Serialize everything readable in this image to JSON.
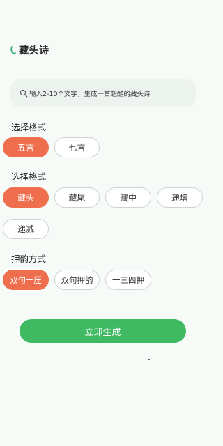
{
  "header": {
    "title": "藏头诗",
    "back_icon": "back-arc-icon"
  },
  "search": {
    "text": "输入2-10个文字，生成一首超酷的藏头诗",
    "icon": "search-icon"
  },
  "sections": [
    {
      "label": "选择格式",
      "options": [
        "五言",
        "七言"
      ],
      "selected": 0
    },
    {
      "label": "选择格式",
      "options": [
        "藏头",
        "藏尾",
        "藏中",
        "递增",
        "递减"
      ],
      "selected": 0
    },
    {
      "label": "押韵方式",
      "options": [
        "双句一压",
        "双句押韵",
        "一三四押"
      ],
      "selected": 0
    }
  ],
  "submit": {
    "label": "立即生成"
  },
  "colors": {
    "accent_orange": "#ee6e4e",
    "accent_green": "#3fba62",
    "background": "#f7fbf8"
  }
}
